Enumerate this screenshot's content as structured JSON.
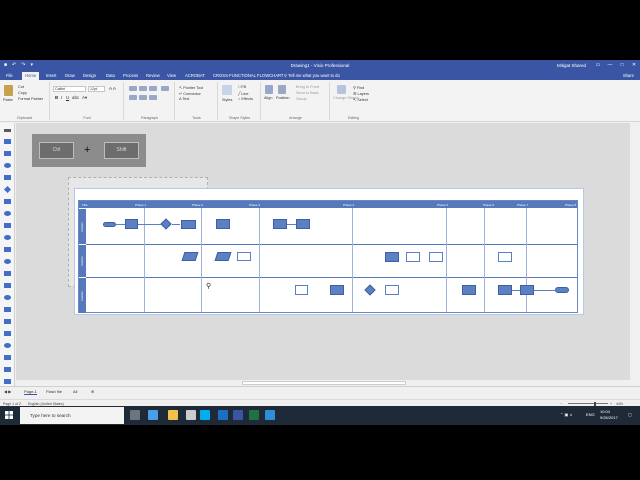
{
  "window": {
    "title": "Drawing1 - Visio Professional",
    "user": "Mitigat Shared",
    "quick_access": [
      "■",
      "↶",
      "↷",
      "▾"
    ],
    "controls": [
      "▭",
      "—",
      "□",
      "✕"
    ]
  },
  "tabs": [
    "File",
    "Home",
    "Insert",
    "Draw",
    "Design",
    "Data",
    "Process",
    "Review",
    "View",
    "ACROBAT",
    "CROSS-FUNCTIONAL FLOWCHART"
  ],
  "tell_me": "Tell me what you want to do",
  "share_label": "Share",
  "ribbon": {
    "clipboard": {
      "paste": "Paste",
      "cut": "Cut",
      "copy": "Copy",
      "format_painter": "Format Painter",
      "label": "Clipboard"
    },
    "font": {
      "family": "Calibri",
      "size": "12pt.",
      "label": "Font"
    },
    "paragraph": {
      "label": "Paragraph"
    },
    "tools": {
      "pointer": "Pointer Tool",
      "connector": "Connector",
      "text": "Text",
      "label": "Tools"
    },
    "shape_styles": {
      "styles": "Styles",
      "fill": "Fill",
      "line": "Line",
      "effects": "Effects",
      "label": "Shape Styles"
    },
    "arrange": {
      "align": "Align",
      "position": "Position",
      "bring_front": "Bring to Front",
      "send_back": "Send to Back",
      "group": "Group",
      "label": "Arrange"
    },
    "editing": {
      "change_shape": "Change Shape",
      "find": "Find",
      "layers": "Layers",
      "select": "Select",
      "label": "Editing"
    }
  },
  "callout": {
    "left": "Ctrl",
    "plus": "+",
    "right": "Shift"
  },
  "flowchart": {
    "title": "Title",
    "phases": [
      "Phase 1",
      "Phase 2",
      "Phase 3",
      "Phase 4",
      "Phase 5",
      "Phase 6",
      "Phase 7",
      "Phase 8"
    ],
    "lanes": [
      "Function",
      "Function",
      "Function"
    ]
  },
  "sheets": {
    "page1": "Page-1",
    "flash": "Flash file",
    "all": "All"
  },
  "status": {
    "page": "Page 1 of 2",
    "lang": "English (United States)",
    "zoom": "44%"
  },
  "taskbar": {
    "search_placeholder": "Type here to search",
    "lang": "ENG",
    "time": "10:04",
    "date": "9/26/2017",
    "apps": [
      {
        "name": "task-view",
        "color": "#ffffff"
      },
      {
        "name": "edge",
        "color": "#4aa0e6"
      },
      {
        "name": "file-explorer",
        "color": "#f2c24a"
      },
      {
        "name": "store",
        "color": "#cccccc"
      },
      {
        "name": "skype",
        "color": "#00aff0"
      },
      {
        "name": "outlook",
        "color": "#1d6fc1"
      },
      {
        "name": "visio",
        "color": "#3955a3"
      },
      {
        "name": "excel",
        "color": "#1f7244"
      },
      {
        "name": "ie",
        "color": "#2d8fd8"
      }
    ]
  }
}
